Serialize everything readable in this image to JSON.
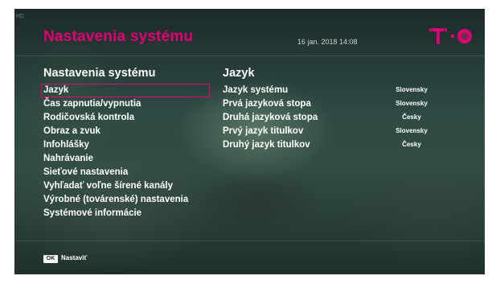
{
  "header": {
    "hd_label": "HD",
    "title": "Nastavenia systému",
    "datetime": "16 jan. 2018 14:08",
    "brand_color": "#e20074"
  },
  "menu": {
    "heading": "Nastavenia systému",
    "items": [
      "Jazyk",
      "Čas zapnutia/vypnutia",
      "Rodičovská kontrola",
      "Obraz a zvuk",
      "Infohlášky",
      "Nahrávanie",
      "Sieťové nastavenia",
      "Vyhľadať voľne šírené kanály",
      "Výrobné (továrenské) nastavenia",
      "Systémové informácie"
    ],
    "selected_index": 0
  },
  "detail": {
    "heading": "Jazyk",
    "rows": [
      {
        "label": "Jazyk systému",
        "value": "Slovensky"
      },
      {
        "label": "Prvá jazyková stopa",
        "value": "Slovensky"
      },
      {
        "label": "Druhá jazyková stopa",
        "value": "Česky"
      },
      {
        "label": "Prvý jazyk titulkov",
        "value": "Slovensky"
      },
      {
        "label": "Druhý jazyk titulkov",
        "value": "Česky"
      }
    ]
  },
  "footer": {
    "ok_key": "OK",
    "hint": "Nastaviť"
  },
  "icons": {
    "logo": "telekom-t-logo"
  }
}
